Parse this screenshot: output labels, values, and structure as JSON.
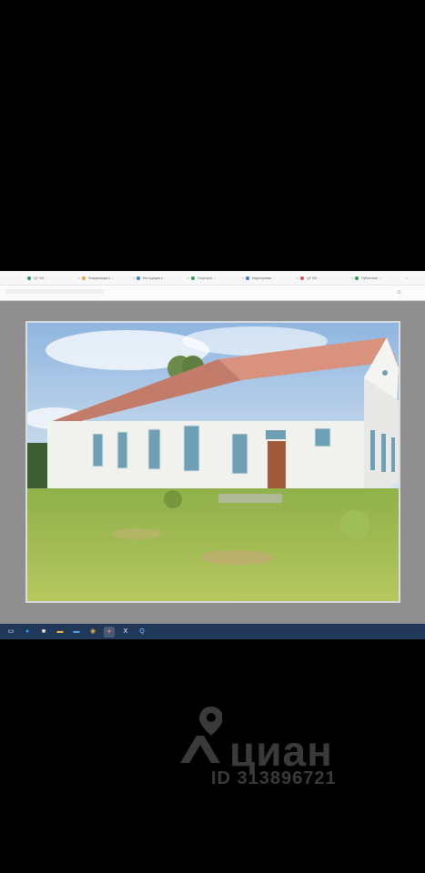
{
  "browser": {
    "tabs": [
      {
        "label": "ЦУ ОИ ...",
        "favicon_color": "#2e9e5b"
      },
      {
        "label": "Информация о ...",
        "favicon_color": "#f2a44a"
      },
      {
        "label": "Инструкция к ...",
        "favicon_color": "#3b7fd9"
      },
      {
        "label": "Госуслуги ...",
        "favicon_color": "#2e9e5b"
      },
      {
        "label": "Кадастровая ...",
        "favicon_color": "#3b7fd9"
      },
      {
        "label": "ЦУ ОИ ...",
        "favicon_color": "#e35050"
      },
      {
        "label": "Публичная ...",
        "favicon_color": "#2e9e5b"
      }
    ],
    "close_glyph": "×"
  },
  "taskbar": {
    "icons": [
      {
        "name": "task-view-icon",
        "glyph": "▭",
        "color": "#ffffff"
      },
      {
        "name": "edge-icon",
        "glyph": "●",
        "color": "#2fa3e3"
      },
      {
        "name": "notes-icon",
        "glyph": "■",
        "color": "#f4f4f4"
      },
      {
        "name": "folder-icon",
        "glyph": "▬",
        "color": "#f5c242"
      },
      {
        "name": "mail-icon",
        "glyph": "▬",
        "color": "#5aa7ef"
      },
      {
        "name": "chrome-icon",
        "glyph": "◉",
        "color": "#e8b33a"
      },
      {
        "name": "yandex-browser-icon",
        "glyph": "●",
        "color": "#ff6b6b"
      },
      {
        "name": "excel-icon",
        "glyph": "X",
        "color": "#ffffff"
      },
      {
        "name": "app-icon",
        "glyph": "Q",
        "color": "#7fd2ff"
      }
    ],
    "active_index": 6
  },
  "watermark": {
    "brand": "циан",
    "id_text": "ID 313896721"
  }
}
